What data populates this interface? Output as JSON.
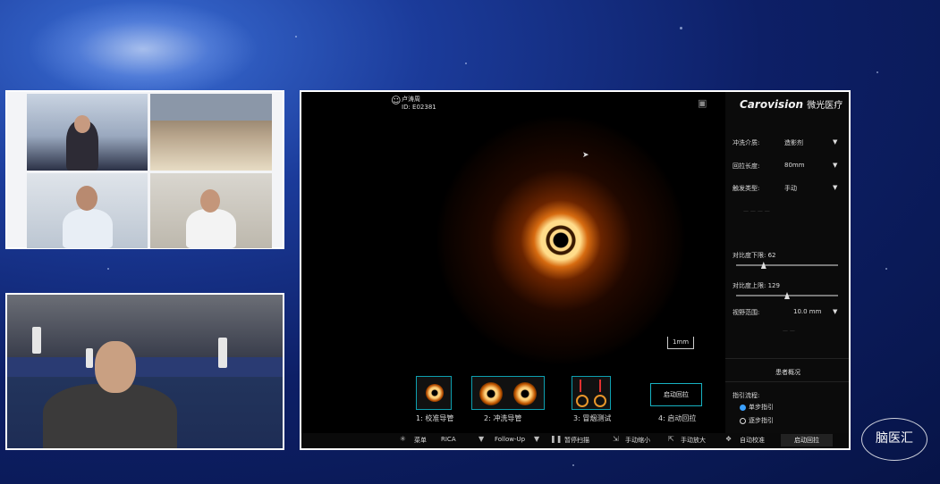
{
  "grid": {
    "name_tag_1": "",
    "name_tag_2": ""
  },
  "oct": {
    "user_name": "卢涛周",
    "user_id": "ID: E02381",
    "scale_label": "1mm",
    "steps": [
      {
        "label": "1:  校准导管"
      },
      {
        "label": "2:  冲洗导管"
      },
      {
        "label": "3:  冒烟测试"
      },
      {
        "label": "4:  启动回拉"
      }
    ],
    "start_button": "启动回拉"
  },
  "panel": {
    "logo_text": "Carovision",
    "logo_cn": "微光医疗",
    "flush_label": "冲洗介质:",
    "flush_value": "造影剂",
    "pullback_label": "回拉长度:",
    "pullback_value": "80mm",
    "trigger_label": "触发类型:",
    "trigger_value": "手动",
    "contrast_low_label": "对比度下限:",
    "contrast_low_value": "62",
    "contrast_low_fraction": 0.27,
    "contrast_high_label": "对比度上限:",
    "contrast_high_value": "129",
    "contrast_high_fraction": 0.5,
    "fov_label": "视野范围:",
    "fov_value": "10.0 mm",
    "patient_button": "患者概况",
    "guide_label": "指引流程:",
    "guide_options": [
      {
        "label": "单步指引",
        "selected": true
      },
      {
        "label": "逐步指引",
        "selected": false
      }
    ]
  },
  "bottombar": {
    "menu": "菜单",
    "vessel": "RICA",
    "mode": "Follow-Up",
    "pause": "暂停扫描",
    "zoom_out": "手动缩小",
    "zoom_in": "手动放大",
    "auto_calib": "自动校准",
    "start_pullback": "启动回拉"
  },
  "watermark": "脑医汇"
}
